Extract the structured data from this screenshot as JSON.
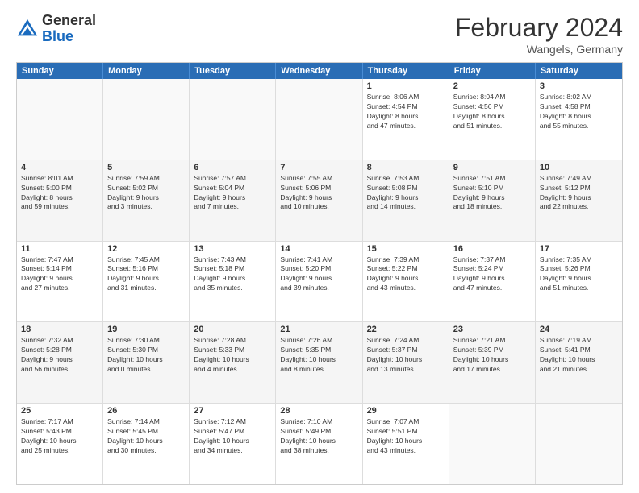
{
  "header": {
    "logo_general": "General",
    "logo_blue": "Blue",
    "main_title": "February 2024",
    "subtitle": "Wangels, Germany"
  },
  "calendar": {
    "days_of_week": [
      "Sunday",
      "Monday",
      "Tuesday",
      "Wednesday",
      "Thursday",
      "Friday",
      "Saturday"
    ],
    "rows": [
      [
        {
          "day": "",
          "text": "",
          "empty": true
        },
        {
          "day": "",
          "text": "",
          "empty": true
        },
        {
          "day": "",
          "text": "",
          "empty": true
        },
        {
          "day": "",
          "text": "",
          "empty": true
        },
        {
          "day": "1",
          "text": "Sunrise: 8:06 AM\nSunset: 4:54 PM\nDaylight: 8 hours\nand 47 minutes."
        },
        {
          "day": "2",
          "text": "Sunrise: 8:04 AM\nSunset: 4:56 PM\nDaylight: 8 hours\nand 51 minutes."
        },
        {
          "day": "3",
          "text": "Sunrise: 8:02 AM\nSunset: 4:58 PM\nDaylight: 8 hours\nand 55 minutes."
        }
      ],
      [
        {
          "day": "4",
          "text": "Sunrise: 8:01 AM\nSunset: 5:00 PM\nDaylight: 8 hours\nand 59 minutes.",
          "shaded": true
        },
        {
          "day": "5",
          "text": "Sunrise: 7:59 AM\nSunset: 5:02 PM\nDaylight: 9 hours\nand 3 minutes.",
          "shaded": true
        },
        {
          "day": "6",
          "text": "Sunrise: 7:57 AM\nSunset: 5:04 PM\nDaylight: 9 hours\nand 7 minutes.",
          "shaded": true
        },
        {
          "day": "7",
          "text": "Sunrise: 7:55 AM\nSunset: 5:06 PM\nDaylight: 9 hours\nand 10 minutes.",
          "shaded": true
        },
        {
          "day": "8",
          "text": "Sunrise: 7:53 AM\nSunset: 5:08 PM\nDaylight: 9 hours\nand 14 minutes.",
          "shaded": true
        },
        {
          "day": "9",
          "text": "Sunrise: 7:51 AM\nSunset: 5:10 PM\nDaylight: 9 hours\nand 18 minutes.",
          "shaded": true
        },
        {
          "day": "10",
          "text": "Sunrise: 7:49 AM\nSunset: 5:12 PM\nDaylight: 9 hours\nand 22 minutes.",
          "shaded": true
        }
      ],
      [
        {
          "day": "11",
          "text": "Sunrise: 7:47 AM\nSunset: 5:14 PM\nDaylight: 9 hours\nand 27 minutes."
        },
        {
          "day": "12",
          "text": "Sunrise: 7:45 AM\nSunset: 5:16 PM\nDaylight: 9 hours\nand 31 minutes."
        },
        {
          "day": "13",
          "text": "Sunrise: 7:43 AM\nSunset: 5:18 PM\nDaylight: 9 hours\nand 35 minutes."
        },
        {
          "day": "14",
          "text": "Sunrise: 7:41 AM\nSunset: 5:20 PM\nDaylight: 9 hours\nand 39 minutes."
        },
        {
          "day": "15",
          "text": "Sunrise: 7:39 AM\nSunset: 5:22 PM\nDaylight: 9 hours\nand 43 minutes."
        },
        {
          "day": "16",
          "text": "Sunrise: 7:37 AM\nSunset: 5:24 PM\nDaylight: 9 hours\nand 47 minutes."
        },
        {
          "day": "17",
          "text": "Sunrise: 7:35 AM\nSunset: 5:26 PM\nDaylight: 9 hours\nand 51 minutes."
        }
      ],
      [
        {
          "day": "18",
          "text": "Sunrise: 7:32 AM\nSunset: 5:28 PM\nDaylight: 9 hours\nand 56 minutes.",
          "shaded": true
        },
        {
          "day": "19",
          "text": "Sunrise: 7:30 AM\nSunset: 5:30 PM\nDaylight: 10 hours\nand 0 minutes.",
          "shaded": true
        },
        {
          "day": "20",
          "text": "Sunrise: 7:28 AM\nSunset: 5:33 PM\nDaylight: 10 hours\nand 4 minutes.",
          "shaded": true
        },
        {
          "day": "21",
          "text": "Sunrise: 7:26 AM\nSunset: 5:35 PM\nDaylight: 10 hours\nand 8 minutes.",
          "shaded": true
        },
        {
          "day": "22",
          "text": "Sunrise: 7:24 AM\nSunset: 5:37 PM\nDaylight: 10 hours\nand 13 minutes.",
          "shaded": true
        },
        {
          "day": "23",
          "text": "Sunrise: 7:21 AM\nSunset: 5:39 PM\nDaylight: 10 hours\nand 17 minutes.",
          "shaded": true
        },
        {
          "day": "24",
          "text": "Sunrise: 7:19 AM\nSunset: 5:41 PM\nDaylight: 10 hours\nand 21 minutes.",
          "shaded": true
        }
      ],
      [
        {
          "day": "25",
          "text": "Sunrise: 7:17 AM\nSunset: 5:43 PM\nDaylight: 10 hours\nand 25 minutes."
        },
        {
          "day": "26",
          "text": "Sunrise: 7:14 AM\nSunset: 5:45 PM\nDaylight: 10 hours\nand 30 minutes."
        },
        {
          "day": "27",
          "text": "Sunrise: 7:12 AM\nSunset: 5:47 PM\nDaylight: 10 hours\nand 34 minutes."
        },
        {
          "day": "28",
          "text": "Sunrise: 7:10 AM\nSunset: 5:49 PM\nDaylight: 10 hours\nand 38 minutes."
        },
        {
          "day": "29",
          "text": "Sunrise: 7:07 AM\nSunset: 5:51 PM\nDaylight: 10 hours\nand 43 minutes."
        },
        {
          "day": "",
          "text": "",
          "empty": true
        },
        {
          "day": "",
          "text": "",
          "empty": true
        }
      ]
    ]
  }
}
